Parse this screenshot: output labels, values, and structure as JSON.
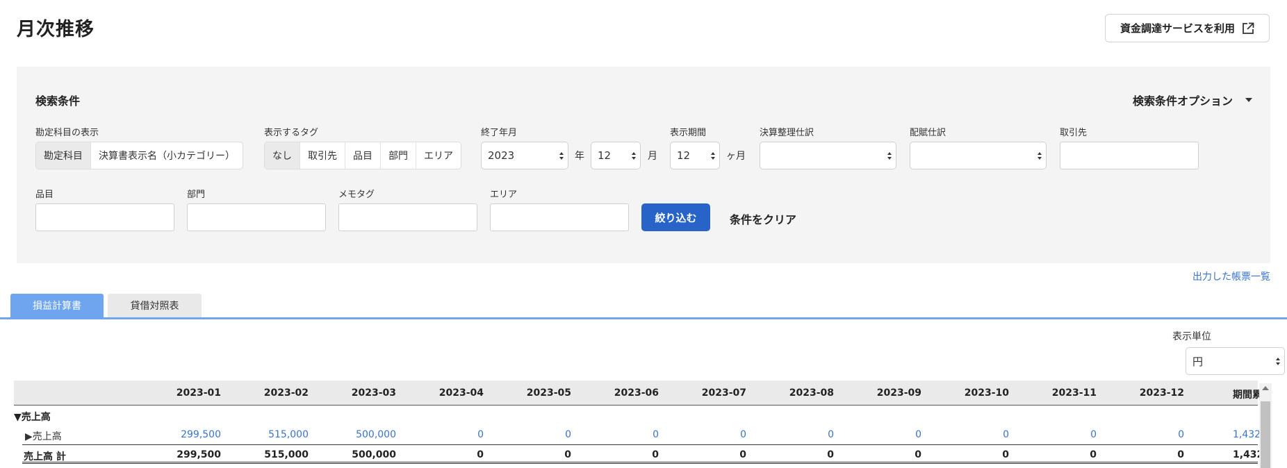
{
  "header": {
    "title": "月次推移",
    "funding_button": "資金調達サービスを利用",
    "funding_icon": "external-link-icon"
  },
  "search": {
    "title": "検索条件",
    "options_label": "検索条件オプション",
    "account_display": {
      "label": "勘定科目の表示",
      "options": [
        "勘定科目",
        "決算書表示名（小カテゴリー）"
      ],
      "selected": "勘定科目"
    },
    "tags": {
      "label": "表示するタグ",
      "options": [
        "なし",
        "取引先",
        "品目",
        "部門",
        "エリア"
      ],
      "selected": "なし"
    },
    "end_month": {
      "label": "終了年月",
      "year": "2023",
      "year_unit": "年",
      "month": "12",
      "month_unit": "月"
    },
    "period": {
      "label": "表示期間",
      "value": "12",
      "unit": "ヶ月"
    },
    "closing_entries": {
      "label": "決算整理仕訳",
      "value": ""
    },
    "allocation_entries": {
      "label": "配賦仕訳",
      "value": ""
    },
    "partner": {
      "label": "取引先",
      "value": ""
    },
    "item": {
      "label": "品目",
      "value": ""
    },
    "department": {
      "label": "部門",
      "value": ""
    },
    "memo_tag": {
      "label": "メモタグ",
      "value": ""
    },
    "area": {
      "label": "エリア",
      "value": ""
    },
    "filter_button": "絞り込む",
    "clear_button": "条件をクリア"
  },
  "report_list_link": "出力した帳票一覧",
  "tabs": [
    {
      "label": "損益計算書",
      "active": true
    },
    {
      "label": "貸借対照表",
      "active": false
    }
  ],
  "display_unit": {
    "label": "表示単位",
    "value": "円"
  },
  "table": {
    "columns": [
      "2023-01",
      "2023-02",
      "2023-03",
      "2023-04",
      "2023-05",
      "2023-06",
      "2023-07",
      "2023-08",
      "2023-09",
      "2023-10",
      "2023-11",
      "2023-12",
      "期間累"
    ],
    "section_label": "▼売上高",
    "rows": [
      {
        "label": "▶売上高",
        "values": [
          "299,500",
          "515,000",
          "500,000",
          "0",
          "0",
          "0",
          "0",
          "0",
          "0",
          "0",
          "0",
          "0",
          "1,432,"
        ]
      },
      {
        "label": "売上高 計",
        "values": [
          "299,500",
          "515,000",
          "500,000",
          "0",
          "0",
          "0",
          "0",
          "0",
          "0",
          "0",
          "0",
          "0",
          "1,432,"
        ]
      }
    ]
  },
  "colors": {
    "accent": "#2864c8",
    "tab_active": "#6ea5ee",
    "link": "#3a73c9",
    "panel_bg": "#f5f4f4"
  }
}
